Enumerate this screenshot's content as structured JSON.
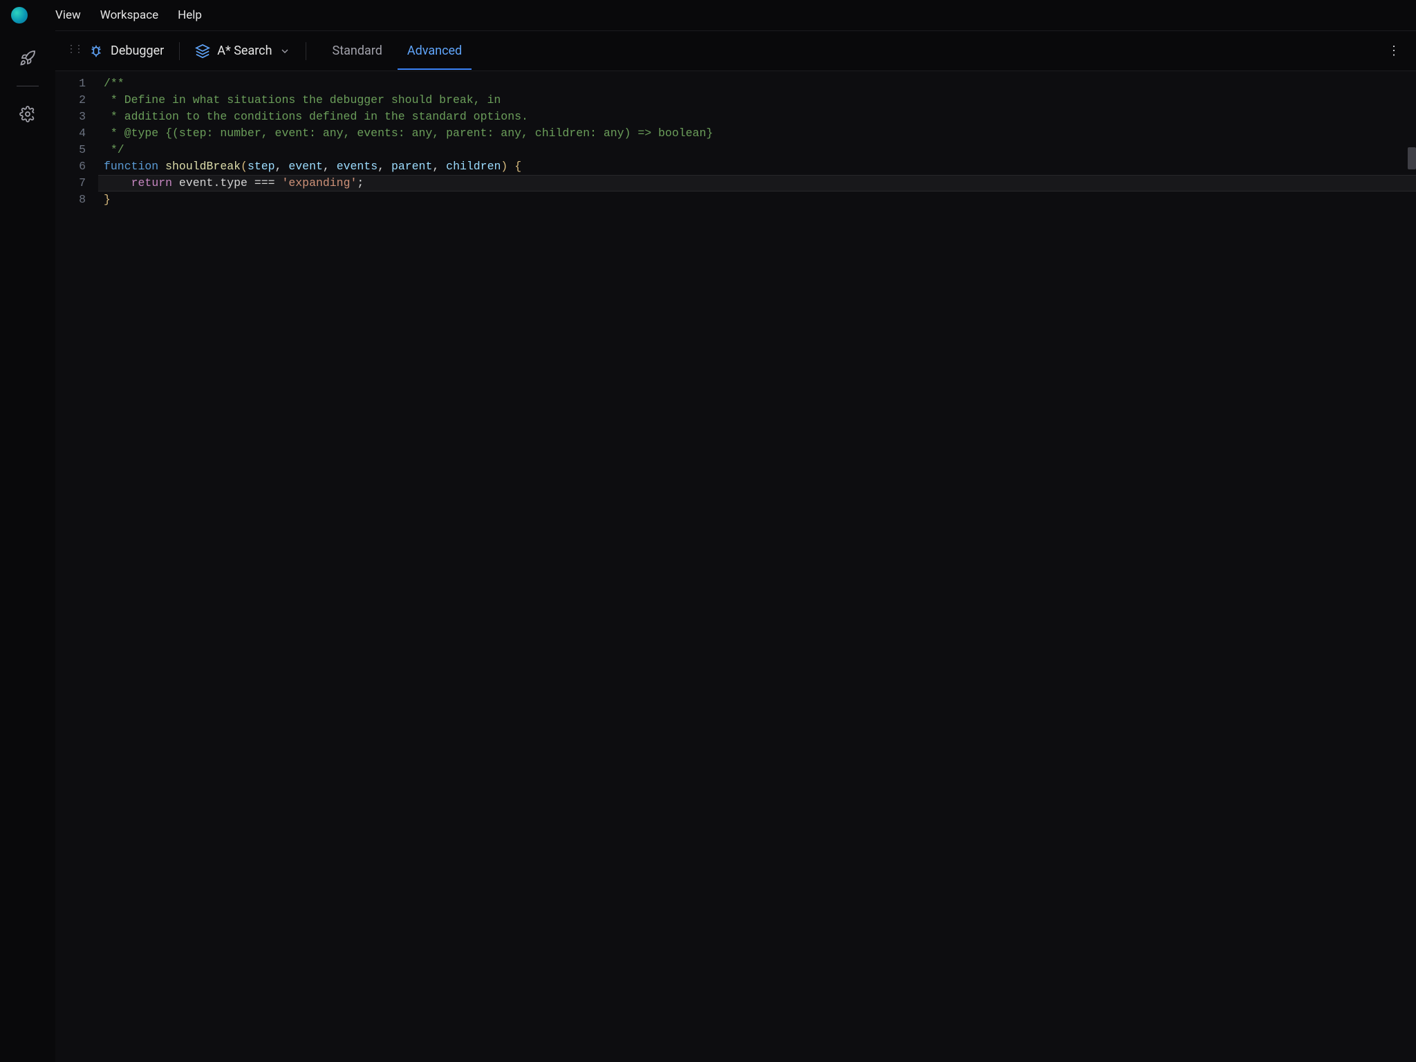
{
  "menubar": {
    "items": [
      "View",
      "Workspace",
      "Help"
    ]
  },
  "sidebar": {
    "buttons": [
      {
        "name": "rocket-icon"
      },
      {
        "name": "gear-icon"
      }
    ]
  },
  "toolbar": {
    "panel_label": "Debugger",
    "algorithm_label": "A* Search",
    "tabs": [
      {
        "label": "Standard",
        "active": false
      },
      {
        "label": "Advanced",
        "active": true
      }
    ]
  },
  "editor": {
    "highlighted_line": 7,
    "lines": [
      {
        "n": 1,
        "tokens": [
          {
            "t": "/**",
            "c": "comment"
          }
        ]
      },
      {
        "n": 2,
        "tokens": [
          {
            "t": " * Define in what situations the debugger should break, in",
            "c": "comment"
          }
        ]
      },
      {
        "n": 3,
        "tokens": [
          {
            "t": " * addition to the conditions defined in the standard options.",
            "c": "comment"
          }
        ]
      },
      {
        "n": 4,
        "tokens": [
          {
            "t": " * @type {(step: number, event: any, events: any, parent: any, children: any) => boolean}",
            "c": "comment"
          }
        ]
      },
      {
        "n": 5,
        "tokens": [
          {
            "t": " */",
            "c": "comment"
          }
        ]
      },
      {
        "n": 6,
        "tokens": [
          {
            "t": "function",
            "c": "keyword"
          },
          {
            "t": " ",
            "c": "plain"
          },
          {
            "t": "shouldBreak",
            "c": "fn"
          },
          {
            "t": "(",
            "c": "paren"
          },
          {
            "t": "step",
            "c": "param"
          },
          {
            "t": ", ",
            "c": "plain"
          },
          {
            "t": "event",
            "c": "param"
          },
          {
            "t": ", ",
            "c": "plain"
          },
          {
            "t": "events",
            "c": "param"
          },
          {
            "t": ", ",
            "c": "plain"
          },
          {
            "t": "parent",
            "c": "param"
          },
          {
            "t": ", ",
            "c": "plain"
          },
          {
            "t": "children",
            "c": "param"
          },
          {
            "t": ")",
            "c": "paren"
          },
          {
            "t": " ",
            "c": "plain"
          },
          {
            "t": "{",
            "c": "brace"
          }
        ]
      },
      {
        "n": 7,
        "tokens": [
          {
            "t": "    ",
            "c": "plain"
          },
          {
            "t": "return",
            "c": "keyword2"
          },
          {
            "t": " event.type === ",
            "c": "plain"
          },
          {
            "t": "'expanding'",
            "c": "string"
          },
          {
            "t": ";",
            "c": "plain"
          }
        ]
      },
      {
        "n": 8,
        "tokens": [
          {
            "t": "}",
            "c": "brace"
          }
        ]
      }
    ]
  }
}
